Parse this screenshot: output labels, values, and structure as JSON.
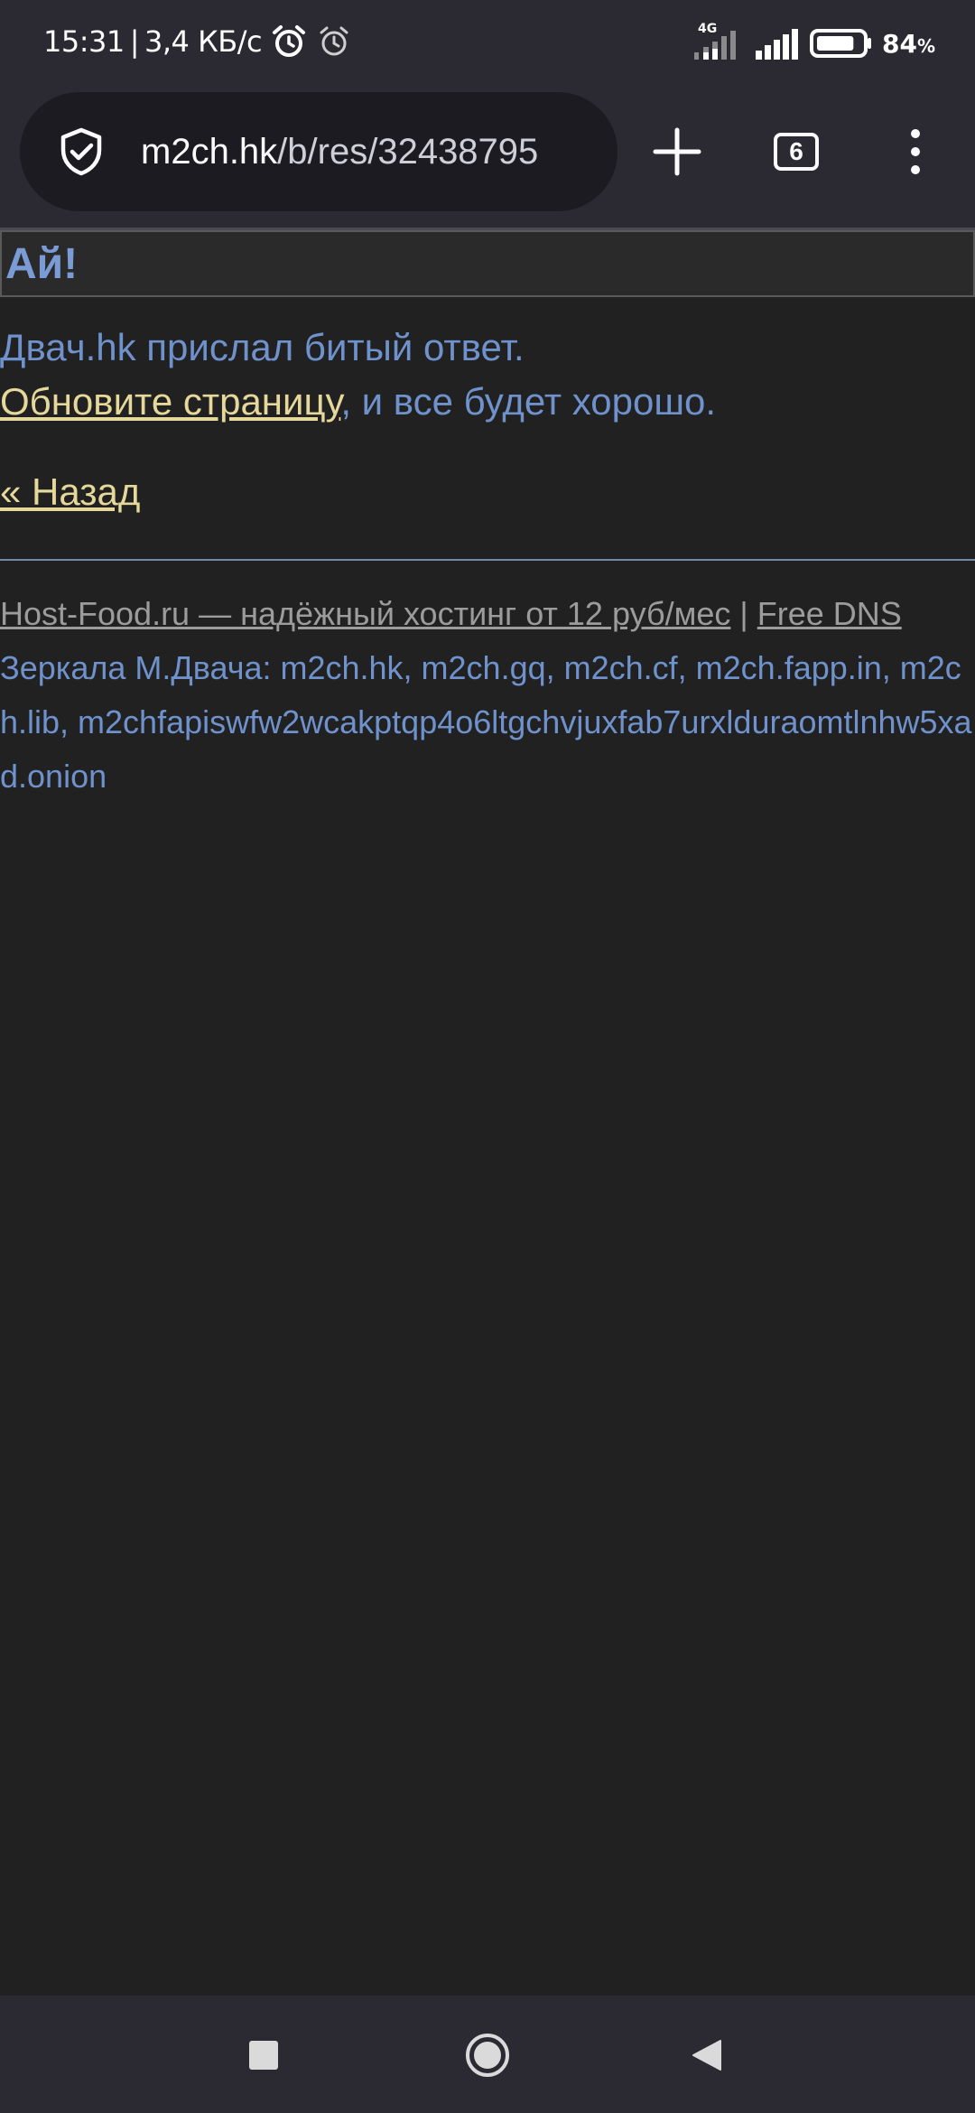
{
  "status_bar": {
    "time": "15:31",
    "separator": "|",
    "net_speed": "3,4 КБ/с",
    "network_type": "4G",
    "battery_percent": "84",
    "battery_unit": "%",
    "battery_level": 0.84,
    "icons": [
      "alarm-clock-icon",
      "alarm-icon",
      "signal-icon",
      "battery-icon"
    ]
  },
  "browser": {
    "url_domain": "m2ch.hk",
    "url_path": "/b/res/32438795",
    "tab_count": "6",
    "icons": [
      "shield-icon",
      "plus-icon",
      "tabs-icon",
      "more-menu-icon"
    ]
  },
  "page": {
    "title": "Ай!",
    "message_line1": "Двач.hk прислал битый ответ.",
    "refresh_link": "Обновите страницу",
    "message_line2_rest": ", и все будет хорошо.",
    "back_link": "« Назад",
    "footer": {
      "hosting_link": "Host-Food.ru — надёжный хостинг от 12 руб/мес",
      "separator": " | ",
      "dns_link": "Free DNS"
    },
    "mirrors_text": "Зеркала М.Двача: m2ch.hk, m2ch.gq, m2ch.cf, m2ch.fapp.in, m2ch.lib, m2chfapiswfw2wcakptqp4o6ltgchvjuxfab7urxlduraomtlnhw5xad.onion"
  },
  "nav_bar": {
    "icons": [
      "recent-apps-icon",
      "home-icon",
      "back-icon"
    ]
  },
  "colors": {
    "background": "#212121",
    "chrome": "#2b2a33",
    "title_blue": "#7b9bd6",
    "text_blue": "#6f92cc",
    "link_yellow": "#e5d89a",
    "footer_gray": "#9c9c9c"
  }
}
